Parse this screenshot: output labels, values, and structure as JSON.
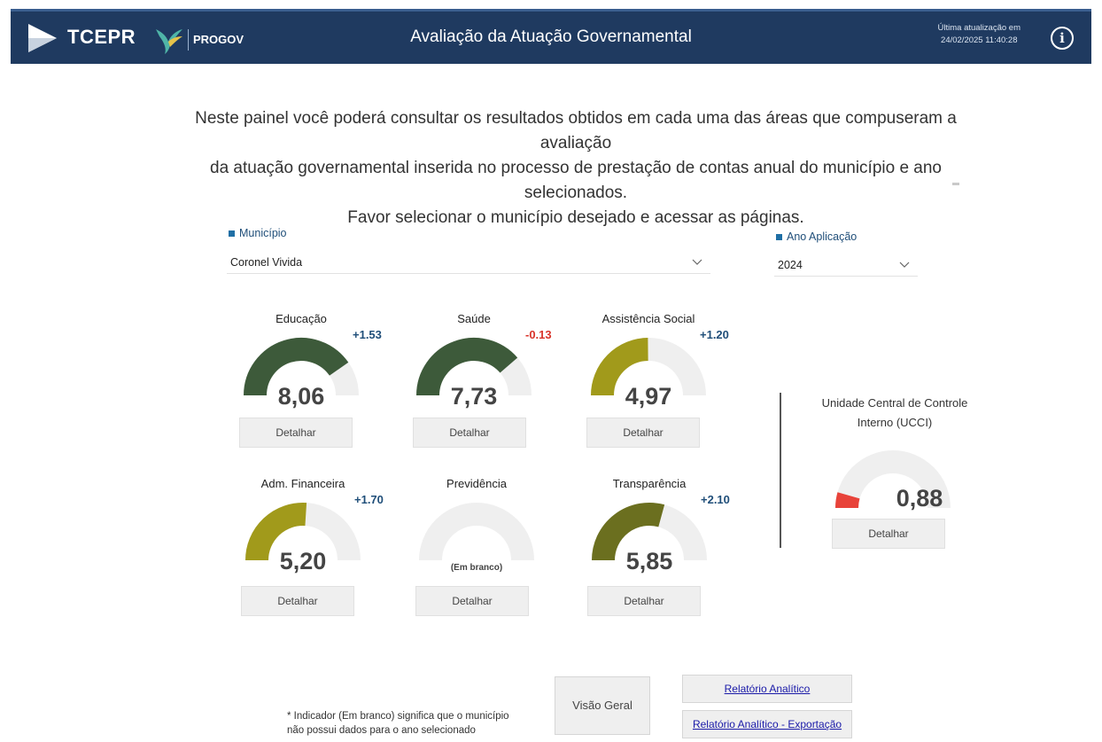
{
  "header": {
    "brand": "TCEPR",
    "system": "PROGOV",
    "title": "Avaliação da Atuação Governamental",
    "last_update_label": "Última atualização em",
    "last_update_value": "24/02/2025 11:40:28",
    "info_glyph": "i",
    "color": "#1f3a60"
  },
  "intro": {
    "line1": "Neste painel você poderá consultar os resultados obtidos em cada uma das áreas que compuseram a avaliação",
    "line2": "da atuação governamental inserida no processo de prestação de contas anual do município e ano selecionados.",
    "line3": "Favor selecionar o município desejado e acessar as páginas."
  },
  "filters": {
    "municipio_label": "Município",
    "municipio_value": "Coronel Vivida",
    "ano_label": "Ano Aplicação",
    "ano_value": "2024"
  },
  "gauges": [
    {
      "title": "Educação",
      "value_text": "8,06",
      "score": 8.06,
      "delta": "+1.53",
      "color": "#3d5a3a",
      "button": "Detalhar"
    },
    {
      "title": "Saúde",
      "value_text": "7,73",
      "score": 7.73,
      "delta": "-0.13",
      "color": "#3d5a3a",
      "button": "Detalhar"
    },
    {
      "title": "Assistência Social",
      "value_text": "4,97",
      "score": 4.97,
      "delta": "+1.20",
      "color": "#a19a1b",
      "button": "Detalhar"
    },
    {
      "title": "Adm. Financeira",
      "value_text": "5,20",
      "score": 5.2,
      "delta": "+1.70",
      "color": "#a19a1b",
      "button": "Detalhar"
    },
    {
      "title": "Previdência",
      "value_text": "",
      "blank_text": "(Em branco)",
      "score": 0,
      "delta": "",
      "color": "#efefef",
      "button": "Detalhar"
    },
    {
      "title": "Transparência",
      "value_text": "5,85",
      "score": 5.85,
      "delta": "+2.10",
      "color": "#6b6f1f",
      "button": "Detalhar"
    }
  ],
  "ucci": {
    "title_line1": "Unidade Central de Controle",
    "title_line2": "Interno (UCCI)",
    "value_text": "0,88",
    "score": 0.88,
    "color": "#e8433a",
    "button": "Detalhar"
  },
  "footer": {
    "note_line1": "* Indicador (Em branco) significa que o município",
    "note_line2": "não possui dados para o ano selecionado",
    "overview_button": "Visão Geral",
    "report_link": "Relatório Analítico",
    "export_link": "Relatório Analítico - Exportação"
  }
}
